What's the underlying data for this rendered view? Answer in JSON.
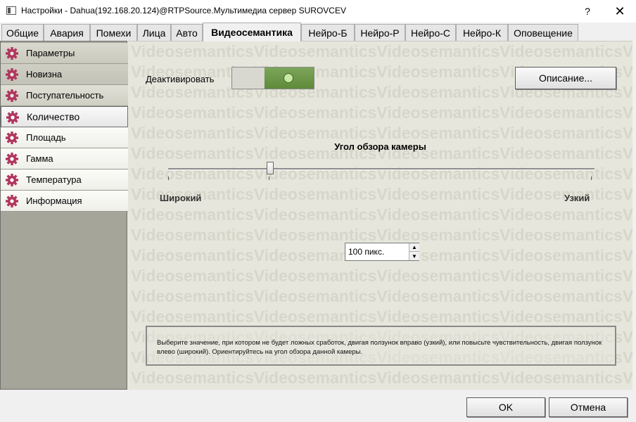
{
  "window": {
    "title": "Настройки - Dahua(192.168.20.124)@RTPSource.Мультимедиа сервер SUROVCEV",
    "help_glyph": "?",
    "close_glyph": "✕"
  },
  "tabs": [
    {
      "label": "Общие"
    },
    {
      "label": "Авария"
    },
    {
      "label": "Помехи"
    },
    {
      "label": "Лица"
    },
    {
      "label": "Авто"
    },
    {
      "label": "Видеосемантика",
      "active": true
    },
    {
      "label": "Нейро-Б"
    },
    {
      "label": "Нейро-Р"
    },
    {
      "label": "Нейро-С"
    },
    {
      "label": "Нейро-К"
    },
    {
      "label": "Оповещение"
    }
  ],
  "sidebar": {
    "items": [
      {
        "label": "Параметры"
      },
      {
        "label": "Новизна"
      },
      {
        "label": "Поступательность"
      },
      {
        "label": "Количество",
        "selected": true
      },
      {
        "label": "Площадь"
      },
      {
        "label": "Гамма"
      },
      {
        "label": "Температура"
      },
      {
        "label": "Информация"
      }
    ],
    "icon_color": "#b0365e"
  },
  "main": {
    "watermark": "Videosemantics",
    "deactivate_label": "Деактивировать",
    "toggle_on": true,
    "description_button": "Описание...",
    "slider": {
      "title": "Угол обзора камеры",
      "left_label": "Широкий",
      "right_label": "Узкий",
      "value_fraction": 0.24
    },
    "spinbox": {
      "value": "100 пикс.",
      "up_glyph": "▲",
      "down_glyph": "▼"
    },
    "hint": "Выберите значение, при котором не будет ложных сработок, двигая ползунок вправо (узкий), или повысьте чувствительность, двигая ползунок влево (широкий). Ориентируйтесь на угол обзора данной камеры."
  },
  "footer": {
    "ok_label": "OK",
    "cancel_label": "Отмена"
  }
}
